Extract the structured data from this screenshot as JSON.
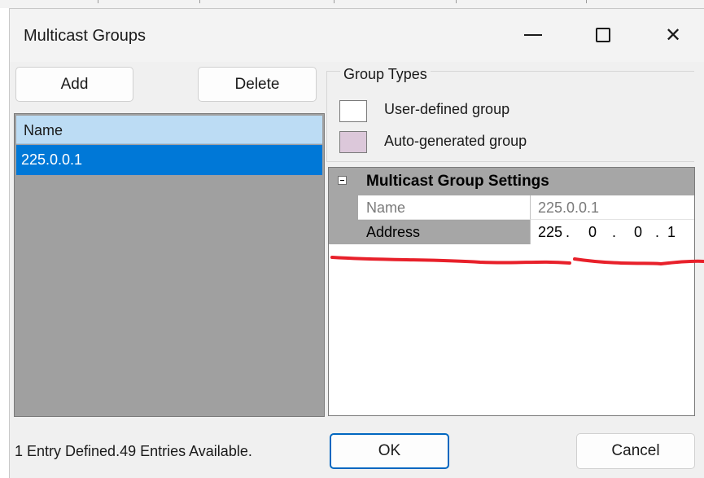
{
  "window": {
    "title": "Multicast Groups",
    "minimize_icon": "minimize-icon",
    "maximize_icon": "maximize-icon",
    "close_icon": "close-icon",
    "close_glyph": "✕"
  },
  "toolbar": {
    "add_label": "Add",
    "delete_label": "Delete"
  },
  "group_list": {
    "header": "Name",
    "items": [
      {
        "name": "225.0.0.1",
        "selected": true
      }
    ]
  },
  "group_types": {
    "title": "Group Types",
    "legend": [
      {
        "label": "User-defined group",
        "color": "#ffffff"
      },
      {
        "label": "Auto-generated group",
        "color": "#dcc8da"
      }
    ]
  },
  "settings": {
    "section_title": "Multicast Group Settings",
    "rows": [
      {
        "label": "Name",
        "value": "225.0.0.1",
        "readonly": true
      },
      {
        "label": "Address",
        "octets": [
          "225",
          "0",
          "0",
          "1"
        ],
        "separator": "."
      }
    ]
  },
  "status": {
    "text": "1 Entry Defined.49 Entries Available."
  },
  "footer": {
    "ok_label": "OK",
    "cancel_label": "Cancel"
  },
  "colors": {
    "selection": "#0078d7",
    "header_bg": "#bcdcf4",
    "list_bg": "#a0a0a0",
    "ok_border": "#0067c0",
    "annotation": "#e8202a"
  }
}
